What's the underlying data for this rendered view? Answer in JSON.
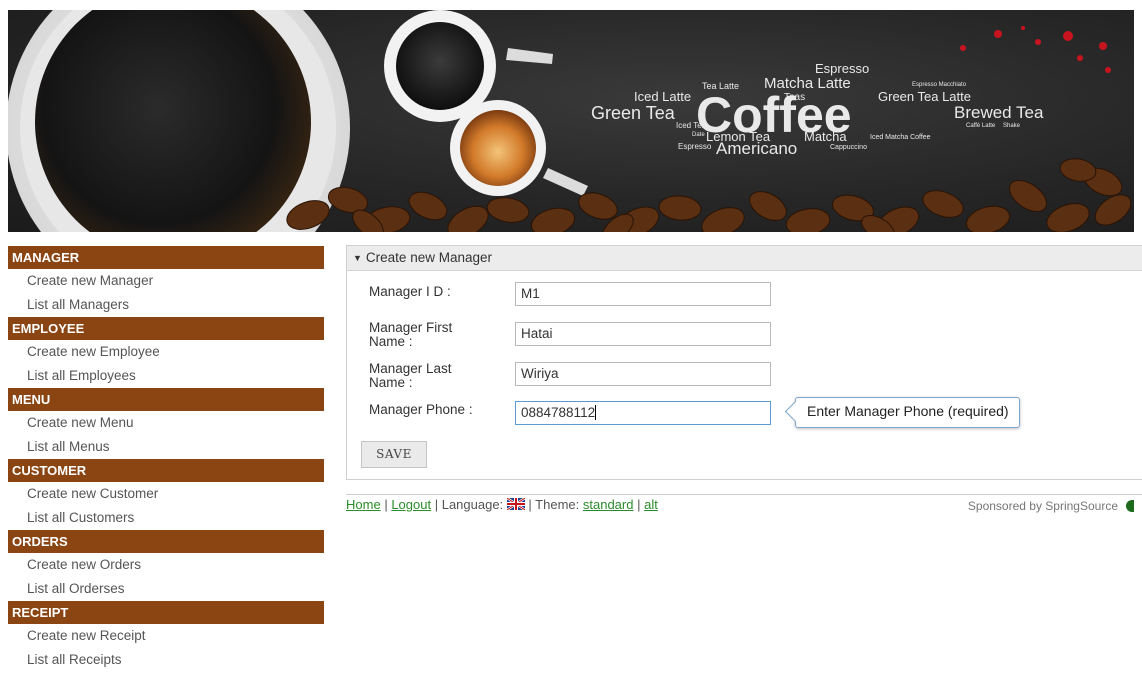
{
  "banner": {
    "words": {
      "espresso": "Espresso",
      "tea_latte": "Tea Latte",
      "matcha_latte": "Matcha Latte",
      "espresso_macchiato": "Espresso Macchiato",
      "iced_latte": "Iced Latte",
      "teas": "Teas",
      "green_tea_latte": "Green Tea Latte",
      "green_tea": "Green Tea",
      "coffee": "Coffee",
      "brewed_tea": "Brewed Tea",
      "iced_tea": "Iced Tea",
      "caffe_latte": "Caffè Latte",
      "shake": "Shake",
      "date": "Date",
      "lemon_tea": "Lemon Tea",
      "matcha": "Matcha",
      "iced_matcha_coffee": "Iced Matcha Coffee",
      "espresso_small": "Espresso",
      "americano": "Americano",
      "cappuccino": "Cappuccino"
    }
  },
  "sidebar": {
    "sections": [
      {
        "title": "MANAGER",
        "items": [
          "Create new Manager",
          "List all Managers"
        ]
      },
      {
        "title": "EMPLOYEE",
        "items": [
          "Create new Employee",
          "List all Employees"
        ]
      },
      {
        "title": "MENU",
        "items": [
          "Create new Menu",
          "List all Menus"
        ]
      },
      {
        "title": "CUSTOMER",
        "items": [
          "Create new Customer",
          "List all Customers"
        ]
      },
      {
        "title": "ORDERS",
        "items": [
          "Create new Orders",
          "List all Orderses"
        ]
      },
      {
        "title": "RECEIPT",
        "items": [
          "Create new Receipt",
          "List all Receipts"
        ]
      }
    ]
  },
  "form": {
    "title": "Create new Manager",
    "fields": [
      {
        "label": "Manager I D :",
        "value": "M1"
      },
      {
        "label": "Manager First Name :",
        "value": "Hatai"
      },
      {
        "label": "Manager Last Name :",
        "value": "Wiriya"
      },
      {
        "label": "Manager Phone :",
        "value": "0884788112"
      }
    ],
    "tooltip": "Enter Manager Phone (required)",
    "save_label": "SAVE"
  },
  "footer": {
    "home": "Home",
    "sep1": "|",
    "logout": "Logout",
    "language_label": "| Language:",
    "theme_label": "| Theme:",
    "theme_standard": "standard",
    "sep2": "|",
    "theme_alt": "alt",
    "sponsored": "Sponsored by SpringSource"
  },
  "colors": {
    "section_header": "#8b4513",
    "link": "#2a8d2a",
    "input_focus": "#5b9bd5"
  }
}
